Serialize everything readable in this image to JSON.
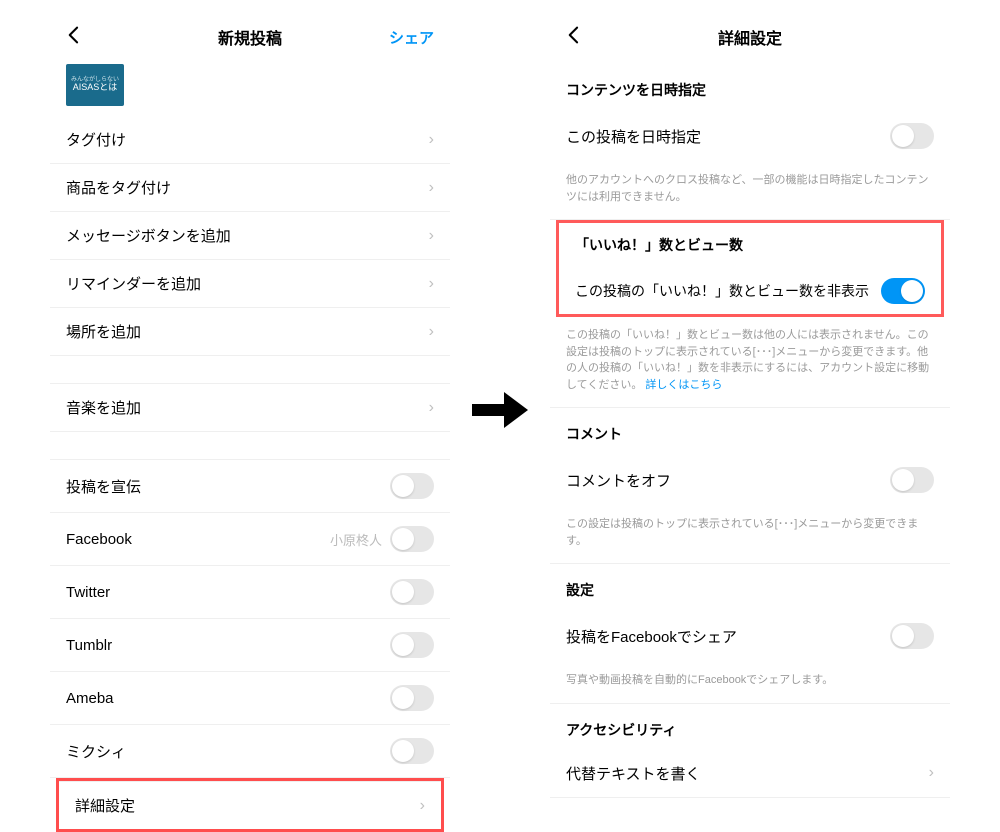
{
  "left": {
    "header": {
      "title": "新規投稿",
      "share": "シェア"
    },
    "thumbnail": {
      "top": "みんながしらない",
      "main": "AISASとは"
    },
    "rows": [
      {
        "label": "タグ付け"
      },
      {
        "label": "商品をタグ付け"
      },
      {
        "label": "メッセージボタンを追加"
      },
      {
        "label": "リマインダーを追加"
      },
      {
        "label": "場所を追加"
      }
    ],
    "music": {
      "label": "音楽を追加"
    },
    "toggles": [
      {
        "label": "投稿を宣伝",
        "on": false
      },
      {
        "label": "Facebook",
        "sub": "小原柊人",
        "on": false
      },
      {
        "label": "Twitter",
        "on": false
      },
      {
        "label": "Tumblr",
        "on": false
      },
      {
        "label": "Ameba",
        "on": false
      },
      {
        "label": "ミクシィ",
        "on": false
      }
    ],
    "advanced": {
      "label": "詳細設定"
    }
  },
  "right": {
    "header": {
      "title": "詳細設定"
    },
    "sch": {
      "title": "コンテンツを日時指定",
      "row_label": "この投稿を日時指定",
      "help": "他のアカウントへのクロス投稿など、一部の機能は日時指定したコンテンツには利用できません。"
    },
    "likes": {
      "title": "「いいね！」数とビュー数",
      "row_label": "この投稿の「いいね！」数とビュー数を非表示",
      "help": "この投稿の「いいね！」数とビュー数は他の人には表示されません。この設定は投稿のトップに表示されている[･･･]メニューから変更できます。他の人の投稿の「いいね！」数を非表示にするには、アカウント設定に移動してください。",
      "link": "詳しくはこちら"
    },
    "comments": {
      "title": "コメント",
      "row_label": "コメントをオフ",
      "help": "この設定は投稿のトップに表示されている[･･･]メニューから変更できます。"
    },
    "settings": {
      "title": "設定",
      "row_label": "投稿をFacebookでシェア",
      "help": "写真や動画投稿を自動的にFacebookでシェアします。"
    },
    "accessibility": {
      "title": "アクセシビリティ",
      "row_label": "代替テキストを書く"
    }
  }
}
